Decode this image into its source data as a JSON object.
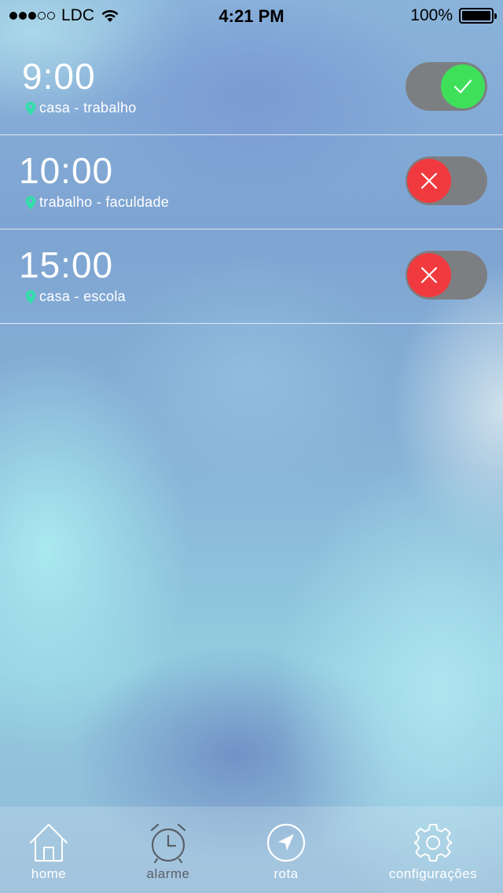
{
  "status_bar": {
    "carrier": "LDC",
    "time": "4:21 PM",
    "battery": "100%",
    "signal_bars_filled": 3,
    "signal_bars_total": 5
  },
  "alarms": [
    {
      "time": "9:00",
      "route": "casa - trabalho",
      "enabled": true
    },
    {
      "time": "10:00",
      "route": "trabalho - faculdade",
      "enabled": false
    },
    {
      "time": "15:00",
      "route": "casa - escola",
      "enabled": false
    }
  ],
  "tab_bar": {
    "home": "home",
    "alarme": "alarme",
    "rota": "rota",
    "configuracoes": "configurações"
  },
  "colors": {
    "toggle_on": "#3ee05a",
    "toggle_off": "#f03a3f",
    "pin": "#2fe0a8",
    "toggle_track": "#7c7f82"
  },
  "icons": {
    "home": "house-icon",
    "alarme": "alarm-clock-icon",
    "rota": "navigation-arrow-icon",
    "configuracoes": "gear-icon"
  }
}
